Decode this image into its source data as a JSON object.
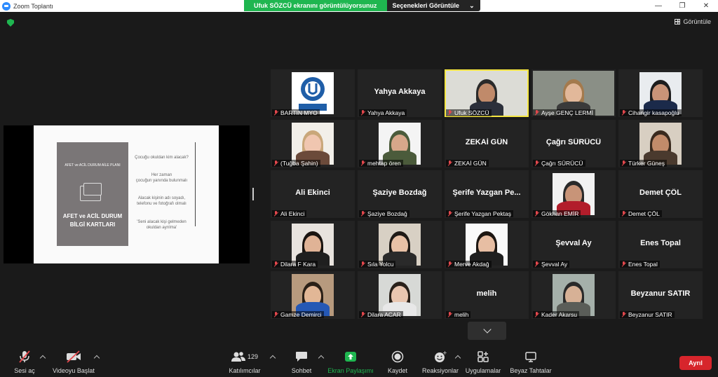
{
  "window": {
    "title": "Zoom Toplantı",
    "minimize": "—",
    "maximize": "❐",
    "close": "✕"
  },
  "share_banner": {
    "message": "Ufuk SÖZCÜ ekranını görüntülüyorsunuz",
    "options_label": "Seçenekleri Görüntüle",
    "options_caret": "⌄"
  },
  "view_button": {
    "label": "Görüntüle"
  },
  "slide": {
    "small_title": "AFET ve ACİL DURUM AİLE PLANI",
    "big_title_line1": "AFET ve ACİL DURUM",
    "big_title_line2": "BİLGİ KARTLARI",
    "lines": [
      "Çocuğu okuldan kim alacak?",
      "Her zaman",
      "çocuğun yanında bulunmalı",
      "Alacak kişinin adı soyadı,",
      "telefonu ve fotoğrafı olmalı",
      "'Seni alacak kişi gelmeden",
      "okuldan ayrılma'"
    ]
  },
  "participants": [
    {
      "name": "BARTIN MYO",
      "type": "logo"
    },
    {
      "name": "Yahya Akkaya",
      "type": "name",
      "big": "Yahya Akkaya"
    },
    {
      "name": "Ufuk SÖZCÜ",
      "type": "landscape",
      "active": true,
      "scheme": "office"
    },
    {
      "name": "Ayşe GENÇ LERMİ",
      "type": "landscape",
      "scheme": "room"
    },
    {
      "name": "Cihangir kasapoğlu",
      "type": "photo",
      "scheme": "man-blue"
    },
    {
      "name": "(Tuğba Şahin)",
      "type": "photo",
      "scheme": "woman-light"
    },
    {
      "name": "mehtap ören",
      "type": "photo",
      "scheme": "hijab"
    },
    {
      "name": "ZEKAİ GÜN",
      "type": "name",
      "big": "ZEKAİ GÜN"
    },
    {
      "name": "Çağrı SÜRÜCÜ",
      "type": "name",
      "big": "Çağrı SÜRÜCÜ"
    },
    {
      "name": "Türker Güneş",
      "type": "photo",
      "scheme": "man-tan"
    },
    {
      "name": "Ali Ekinci",
      "type": "name",
      "big": "Ali Ekinci"
    },
    {
      "name": "Şaziye Bozdağ",
      "type": "name",
      "big": "Şaziye Bozdağ"
    },
    {
      "name": "Şerife Yazgan Pektaş",
      "type": "name",
      "big": "Şerife Yazgan Pe..."
    },
    {
      "name": "Gökhan EMİR",
      "type": "photo",
      "scheme": "man-white"
    },
    {
      "name": "Demet ÇÖL",
      "type": "name",
      "big": "Demet ÇÖL"
    },
    {
      "name": "Dilara F Kara",
      "type": "photo",
      "scheme": "woman-dark"
    },
    {
      "name": "Sıla Yolcu",
      "type": "photo",
      "scheme": "woman-hat"
    },
    {
      "name": "Merve Akdağ",
      "type": "photo",
      "scheme": "woman-white"
    },
    {
      "name": "Şevval Ay",
      "type": "name",
      "big": "Şevval Ay"
    },
    {
      "name": "Enes Topal",
      "type": "name",
      "big": "Enes Topal"
    },
    {
      "name": "Gamze Demirci",
      "type": "photo",
      "scheme": "woman-blue"
    },
    {
      "name": "Dilara ACAR",
      "type": "photo",
      "scheme": "woman-pale"
    },
    {
      "name": "melih",
      "type": "name",
      "big": "melih"
    },
    {
      "name": "Kader Akarsu",
      "type": "photo",
      "scheme": "man-outdoor"
    },
    {
      "name": "Beyzanur SATIR",
      "type": "name",
      "big": "Beyzanur SATIR"
    }
  ],
  "toolbar": {
    "audio": "Sesi aç",
    "video": "Videoyu Başlat",
    "participants": "Katılımcılar",
    "participants_count": "129",
    "chat": "Sohbet",
    "share": "Ekran Paylaşımı",
    "record": "Kaydet",
    "reactions": "Reaksiyonlar",
    "apps": "Uygulamalar",
    "whiteboard": "Beyaz Tahtalar",
    "end": "Ayrıl"
  },
  "colors": {
    "accent_green": "#1fb650",
    "active_speaker": "#f5e642",
    "end_red": "#d7252c",
    "muted_red": "#e5484d"
  }
}
